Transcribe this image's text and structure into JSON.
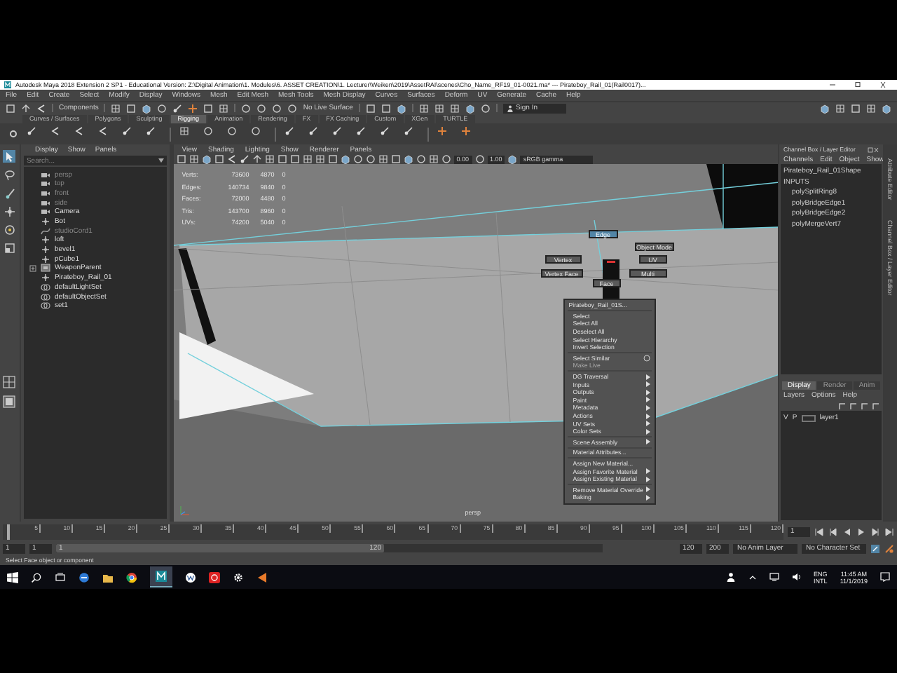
{
  "window": {
    "title": "Autodesk Maya 2018 Extension 2 SP1 - Educational Version: Z:\\Digital Animation\\1. Modules\\6. ASSET CREATION\\1. Lecturer\\Weiken\\2019\\AssetRAI\\scenes\\Cho_Name_RF19_01-0021.ma* --- Pirateboy_Rail_01(Rail0017)..."
  },
  "menu_bar": [
    "File",
    "Edit",
    "Create",
    "Select",
    "Modify",
    "Display",
    "Windows",
    "Mesh",
    "Edit Mesh",
    "Mesh Tools",
    "Mesh Display",
    "Curves",
    "Surfaces",
    "Deform",
    "UV",
    "Generate",
    "Cache",
    "Help"
  ],
  "status_line": {
    "selection_mode": "Components",
    "live_surface": "No Live Surface",
    "account": "Sign In"
  },
  "shelf": {
    "tabs": [
      {
        "label": "Curves / Surfaces",
        "selected": false
      },
      {
        "label": "Polygons",
        "selected": false
      },
      {
        "label": "Sculpting",
        "selected": false
      },
      {
        "label": "Rigging",
        "selected": true
      },
      {
        "label": "Animation",
        "selected": false
      },
      {
        "label": "Rendering",
        "selected": false
      },
      {
        "label": "FX",
        "selected": false
      },
      {
        "label": "FX Caching",
        "selected": false
      },
      {
        "label": "Custom",
        "selected": false
      },
      {
        "label": "XGen",
        "selected": false
      },
      {
        "label": "TURTLE",
        "selected": false
      }
    ]
  },
  "outliner": {
    "menus": [
      "Display",
      "Show",
      "Panels"
    ],
    "search": {
      "placeholder": "Search..."
    },
    "items": [
      {
        "label": "persp",
        "kind": "camera",
        "hidden": true
      },
      {
        "label": "top",
        "kind": "camera",
        "hidden": true
      },
      {
        "label": "front",
        "kind": "camera",
        "hidden": true
      },
      {
        "label": "side",
        "kind": "camera",
        "hidden": true
      },
      {
        "label": "Camera",
        "kind": "camera",
        "hidden": false
      },
      {
        "label": "Bot",
        "kind": "transform",
        "hidden": false
      },
      {
        "label": "studioCord1",
        "kind": "curve",
        "hidden": true
      },
      {
        "label": "loft",
        "kind": "transform",
        "hidden": false
      },
      {
        "label": "bevel1",
        "kind": "transform",
        "hidden": false
      },
      {
        "label": "pCube1",
        "kind": "transform",
        "hidden": false
      },
      {
        "label": "WeaponParent",
        "kind": "group",
        "hidden": false
      },
      {
        "label": "Pirateboy_Rail_01",
        "kind": "transform",
        "hidden": false
      },
      {
        "label": "defaultLightSet",
        "kind": "set",
        "hidden": false
      },
      {
        "label": "defaultObjectSet",
        "kind": "set",
        "hidden": false
      },
      {
        "label": "set1",
        "kind": "set",
        "hidden": false
      }
    ]
  },
  "viewport": {
    "menus": [
      "View",
      "Shading",
      "Lighting",
      "Show",
      "Renderer",
      "Panels"
    ],
    "exposure": "0.00",
    "gamma": "1.00",
    "color_space": "sRGB gamma",
    "hud": [
      {
        "label": "Verts:",
        "values": [
          "73600",
          "4870",
          "0"
        ]
      },
      {
        "label": "Edges:",
        "values": [
          "140734",
          "9840",
          "0"
        ]
      },
      {
        "label": "Faces:",
        "values": [
          "72000",
          "4480",
          "0"
        ]
      },
      {
        "label": "Tris:",
        "values": [
          "143700",
          "8960",
          "0"
        ]
      },
      {
        "label": "UVs:",
        "values": [
          "74200",
          "5040",
          "0"
        ]
      }
    ],
    "camera": "persp",
    "marking_menu": [
      {
        "label": "Edge",
        "selected": true
      },
      {
        "label": "Object Mode",
        "selected": false
      },
      {
        "label": "Vertex",
        "selected": false
      },
      {
        "label": "UV",
        "selected": false
      },
      {
        "label": "Vertex Face",
        "selected": false
      },
      {
        "label": "Multi",
        "selected": false
      },
      {
        "label": "Face",
        "selected": false
      }
    ],
    "context_menu": [
      {
        "kind": "header",
        "label": "Pirateboy_Rail_01S..."
      },
      {
        "kind": "separator"
      },
      {
        "kind": "item",
        "label": "Select",
        "submenu": false,
        "disabled": false
      },
      {
        "kind": "item",
        "label": "Select All",
        "submenu": false,
        "disabled": false
      },
      {
        "kind": "item",
        "label": "Deselect All",
        "submenu": false,
        "disabled": false
      },
      {
        "kind": "item",
        "label": "Select Hierarchy",
        "submenu": false,
        "disabled": false
      },
      {
        "kind": "item",
        "label": "Invert Selection",
        "submenu": false,
        "disabled": false
      },
      {
        "kind": "separator"
      },
      {
        "kind": "option",
        "label": "Select Similar",
        "submenu": false,
        "disabled": false
      },
      {
        "kind": "item",
        "label": "Make Live",
        "submenu": false,
        "disabled": true
      },
      {
        "kind": "separator"
      },
      {
        "kind": "item",
        "label": "DG Traversal",
        "submenu": true,
        "disabled": false
      },
      {
        "kind": "item",
        "label": "Inputs",
        "submenu": true,
        "disabled": false
      },
      {
        "kind": "item",
        "label": "Outputs",
        "submenu": true,
        "disabled": false
      },
      {
        "kind": "item",
        "label": "Paint",
        "submenu": true,
        "disabled": false
      },
      {
        "kind": "item",
        "label": "Metadata",
        "submenu": true,
        "disabled": false
      },
      {
        "kind": "item",
        "label": "Actions",
        "submenu": true,
        "disabled": false
      },
      {
        "kind": "item",
        "label": "UV Sets",
        "submenu": true,
        "disabled": false
      },
      {
        "kind": "item",
        "label": "Color Sets",
        "submenu": true,
        "disabled": false
      },
      {
        "kind": "separator"
      },
      {
        "kind": "item",
        "label": "Scene Assembly",
        "submenu": true,
        "disabled": false
      },
      {
        "kind": "separator"
      },
      {
        "kind": "item",
        "label": "Material Attributes...",
        "submenu": false,
        "disabled": false
      },
      {
        "kind": "separator"
      },
      {
        "kind": "item",
        "label": "Assign New Material...",
        "submenu": false,
        "disabled": false
      },
      {
        "kind": "item",
        "label": "Assign Favorite Material",
        "submenu": true,
        "disabled": false
      },
      {
        "kind": "item",
        "label": "Assign Existing Material",
        "submenu": true,
        "disabled": false
      },
      {
        "kind": "separator"
      },
      {
        "kind": "item",
        "label": "Remove Material Override",
        "submenu": true,
        "disabled": false
      },
      {
        "kind": "item",
        "label": "Baking",
        "submenu": true,
        "disabled": false
      }
    ]
  },
  "channel_box": {
    "title": "Channel Box / Layer Editor",
    "menus": [
      "Channels",
      "Edit",
      "Object",
      "Show"
    ],
    "object": "Pirateboy_Rail_01Shape",
    "inputs_label": "INPUTS",
    "inputs": [
      "polySplitRing8",
      "polyBridgeEdge1",
      "polyBridgeEdge2",
      "polyMergeVert7"
    ],
    "layer_tabs": [
      {
        "label": "Display",
        "selected": true
      },
      {
        "label": "Render",
        "selected": false
      },
      {
        "label": "Anim",
        "selected": false
      }
    ],
    "layer_menus": [
      "Layers",
      "Options",
      "Help"
    ],
    "layers": [
      {
        "visible": "V",
        "playback": "P",
        "name": "layer1"
      }
    ]
  },
  "side_tabs": [
    "Attribute Editor",
    "Channel Box / Layer Editor"
  ],
  "timeline": {
    "ticks": [
      "5",
      "10",
      "15",
      "20",
      "25",
      "30",
      "35",
      "40",
      "45",
      "50",
      "55",
      "60",
      "65",
      "70",
      "75",
      "80",
      "85",
      "90",
      "95",
      "100",
      "105",
      "110",
      "115",
      "120"
    ],
    "current_frame": "1",
    "level": 0
  },
  "range": {
    "start": "1",
    "playback_start": "1",
    "slider_start": "1",
    "slider_end": "120",
    "level": 0.6,
    "playback_end": "120",
    "end": "200",
    "anim_layer": "No Anim Layer",
    "character_set": "No Character Set"
  },
  "help_line": "Select Face object or component",
  "taskbar": {
    "language": "ENG",
    "layout": "INTL",
    "time": "11:45 AM",
    "date": "11/1/2019"
  }
}
